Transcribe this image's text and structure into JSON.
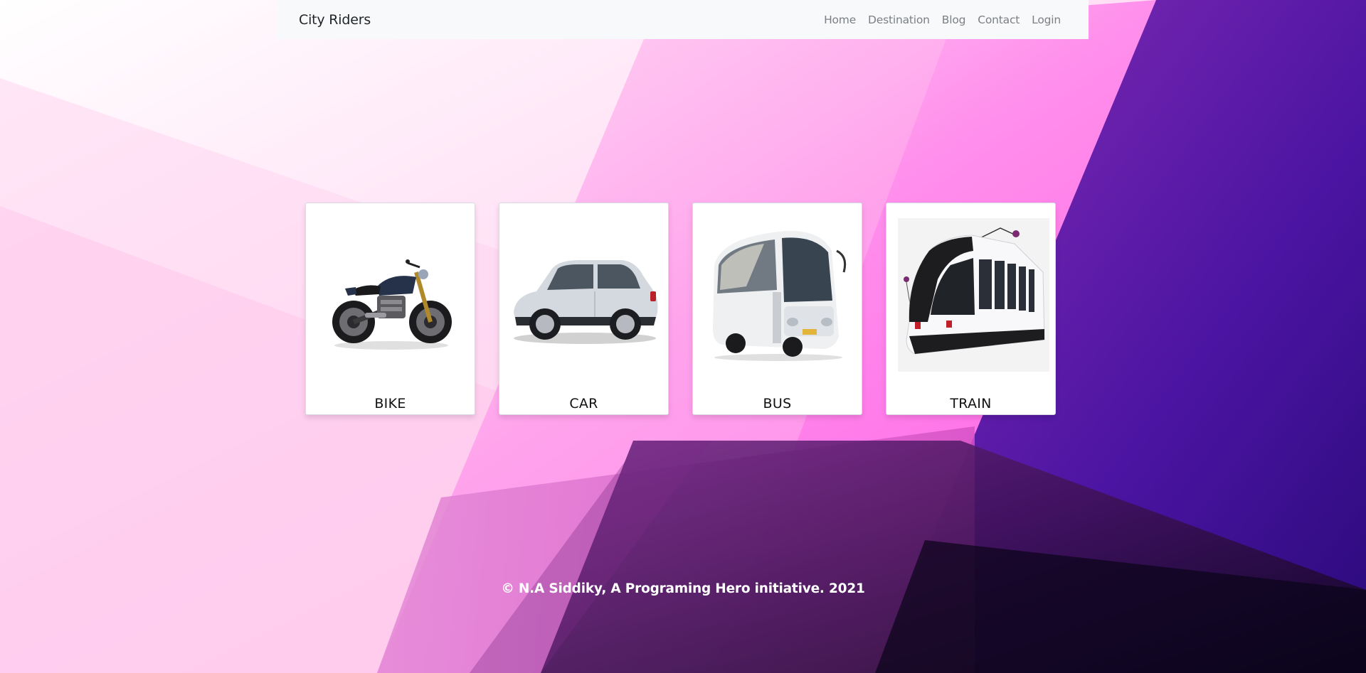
{
  "navbar": {
    "brand": "City Riders",
    "links": [
      {
        "label": "Home"
      },
      {
        "label": "Destination"
      },
      {
        "label": "Blog"
      },
      {
        "label": "Contact"
      },
      {
        "label": "Login"
      }
    ],
    "background": "#f8f9fa"
  },
  "vehicles": [
    {
      "label": "BIKE",
      "icon": "motorcycle-icon"
    },
    {
      "label": "CAR",
      "icon": "car-icon"
    },
    {
      "label": "BUS",
      "icon": "bus-icon"
    },
    {
      "label": "TRAIN",
      "icon": "train-icon"
    }
  ],
  "footer": {
    "text": "© N.A Siddiky, A Programing Hero initiative. 2021"
  },
  "colors": {
    "pink": "#ff4fe6",
    "purple": "#6b22b0",
    "deep_purple": "#2a0a5e",
    "navy": "#0a0a2e"
  }
}
